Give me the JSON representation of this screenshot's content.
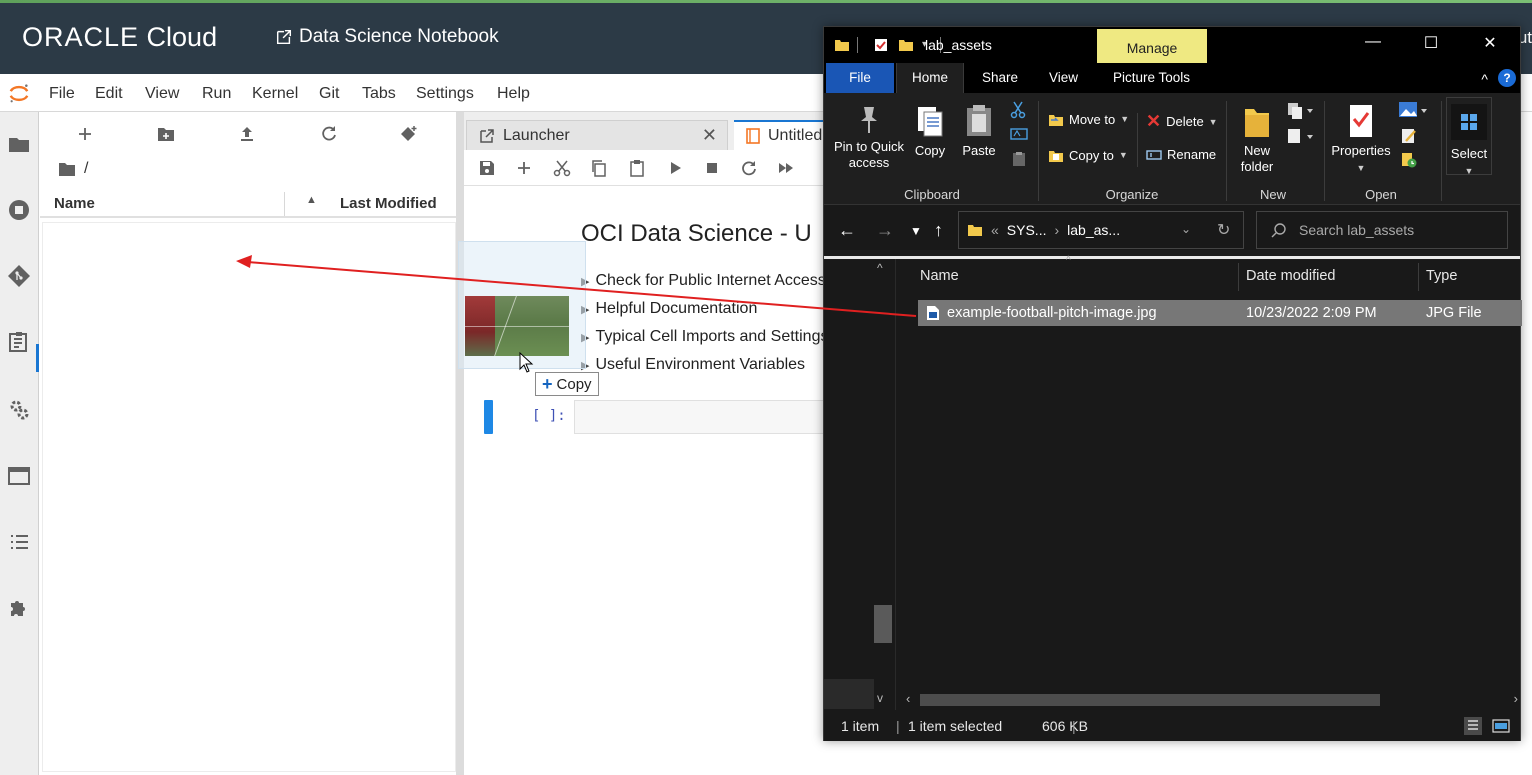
{
  "topbar": {
    "brand_bold": "ORACLE",
    "brand_light": " Cloud",
    "notebook_link": "Data Science Notebook",
    "trailing_text": "ut"
  },
  "jupyter": {
    "menu": [
      "File",
      "Edit",
      "View",
      "Run",
      "Kernel",
      "Git",
      "Tabs",
      "Settings",
      "Help"
    ],
    "filebrowser": {
      "path": "/",
      "col_name": "Name",
      "col_modified": "Last Modified"
    },
    "tabs": {
      "launcher": "Launcher",
      "untitled": "Untitled"
    },
    "notebook": {
      "title": "OCI Data Science - U",
      "headings": [
        "Check for Public Internet Access",
        "Helpful Documentation",
        "Typical Cell Imports and Settings",
        "Useful Environment Variables"
      ],
      "prompt": "[ ]:"
    }
  },
  "drag": {
    "copy_label": "Copy"
  },
  "explorer": {
    "title": "lab_assets",
    "manage": "Manage",
    "ribbon_tabs": {
      "file": "File",
      "home": "Home",
      "share": "Share",
      "view": "View",
      "picture_tools": "Picture Tools"
    },
    "ribbon": {
      "pin": "Pin to Quick access",
      "copy": "Copy",
      "paste": "Paste",
      "clipboard": "Clipboard",
      "move_to": "Move to",
      "copy_to": "Copy to",
      "delete": "Delete",
      "rename": "Rename",
      "organize": "Organize",
      "new_folder": "New folder",
      "new": "New",
      "properties": "Properties",
      "open": "Open",
      "select": "Select"
    },
    "address": {
      "root": "SYS...",
      "folder": "lab_as...",
      "search_placeholder": "Search lab_assets"
    },
    "columns": {
      "name": "Name",
      "date": "Date modified",
      "type": "Type"
    },
    "files": [
      {
        "name": "example-football-pitch-image.jpg",
        "date": "10/23/2022 2:09 PM",
        "type": "JPG File"
      }
    ],
    "status": {
      "count": "1 item",
      "selected": "1 item selected",
      "size": "606 KB"
    }
  },
  "colors": {
    "oci_bar": "#2c3a46",
    "explorer_bg": "#191919",
    "manage_tab": "#efe982",
    "file_tab": "#1a56b5",
    "drag_arrow": "#e02020",
    "cell_marker": "#1e88e5"
  }
}
